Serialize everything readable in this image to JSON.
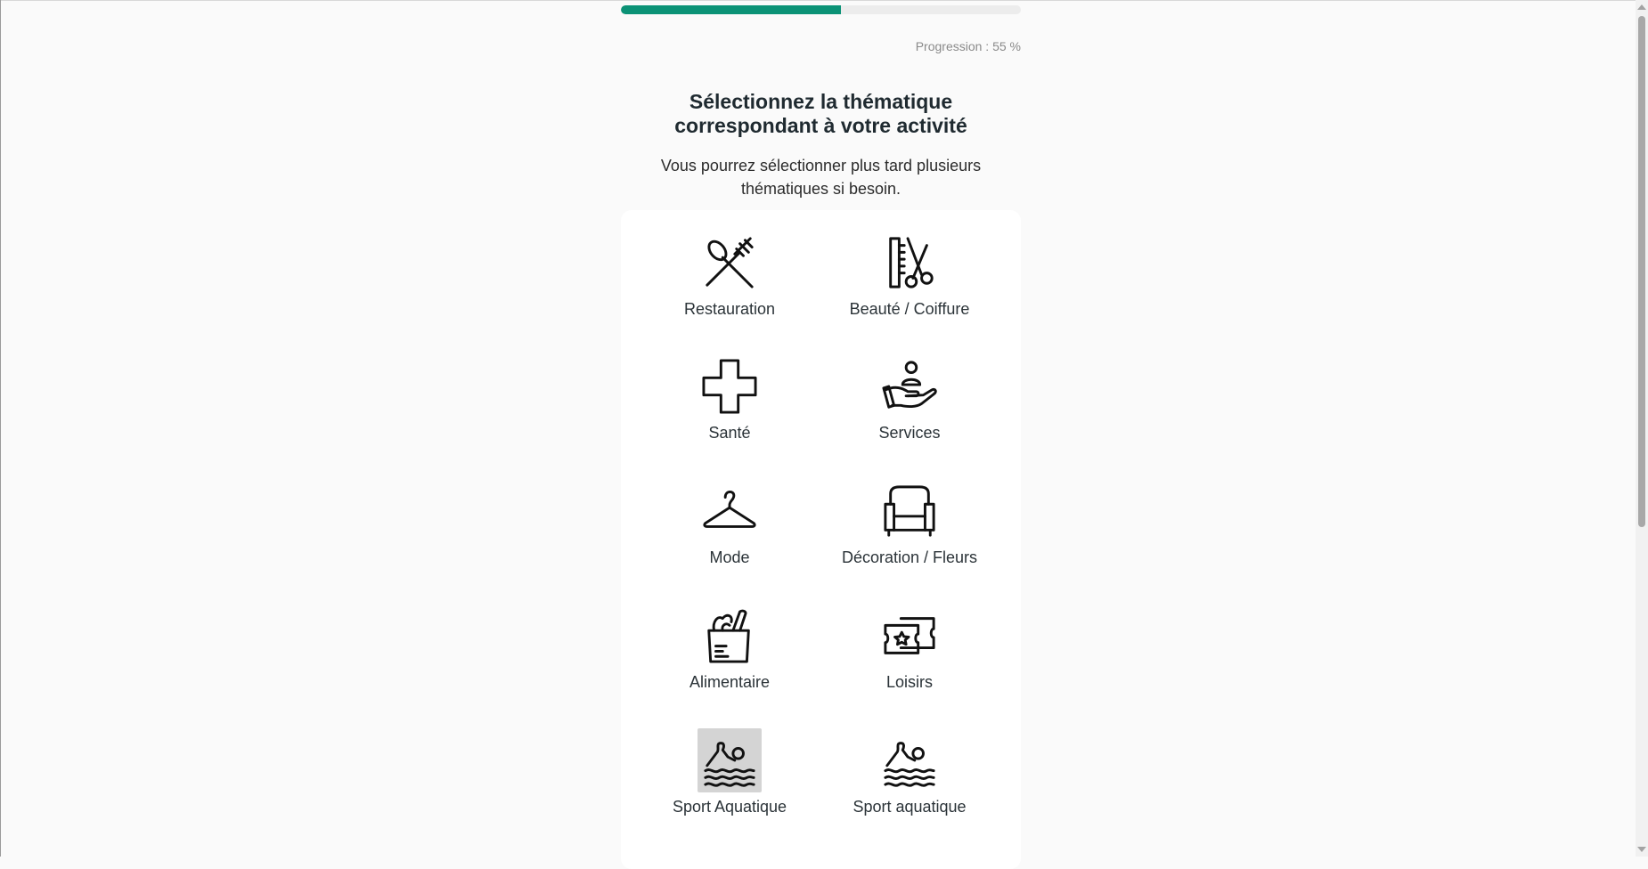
{
  "progress": {
    "value_percent": 55,
    "label": "Progression : 55 %",
    "color": "#0b9276"
  },
  "header": {
    "title_line1": "Sélectionnez la thématique",
    "title_line2": "correspondant à votre activité",
    "subtitle_line1": "Vous pourrez sélectionner plus tard plusieurs",
    "subtitle_line2": "thématiques si besoin."
  },
  "themes": [
    {
      "label": "Restauration",
      "icon": "spoon-fork-icon"
    },
    {
      "label": "Beauté / Coiffure",
      "icon": "comb-scissors-icon"
    },
    {
      "label": "Santé",
      "icon": "medical-cross-icon"
    },
    {
      "label": "Services",
      "icon": "hand-person-icon"
    },
    {
      "label": "Mode",
      "icon": "hanger-icon"
    },
    {
      "label": "Décoration / Fleurs",
      "icon": "armchair-icon"
    },
    {
      "label": "Alimentaire",
      "icon": "grocery-bag-icon"
    },
    {
      "label": "Loisirs",
      "icon": "ticket-icon"
    },
    {
      "label": "Sport Aquatique",
      "icon": "swimmer-icon",
      "highlighted": true
    },
    {
      "label": "Sport aquatique",
      "icon": "swimmer-icon"
    }
  ]
}
